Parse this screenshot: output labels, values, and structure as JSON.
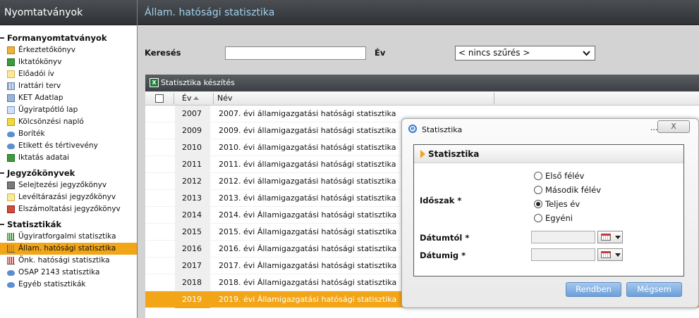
{
  "sidebar": {
    "title": "Nyomtatványok",
    "sections": [
      {
        "label": "Formanyomtatványok",
        "items": [
          {
            "label": "Érkeztetőkönyv",
            "icon": "book-icon"
          },
          {
            "label": "Iktatókönyv",
            "icon": "check-icon"
          },
          {
            "label": "Előadói ív",
            "icon": "note-icon"
          },
          {
            "label": "Irattári terv",
            "icon": "grid-icon"
          },
          {
            "label": "KET Adatlap",
            "icon": "form-icon"
          },
          {
            "label": "Ügyiratpótló lap",
            "icon": "page-icon"
          },
          {
            "label": "Kölcsönzési napló",
            "icon": "log-icon"
          },
          {
            "label": "Boríték",
            "icon": "envelope-icon"
          },
          {
            "label": "Etikett és tértivevény",
            "icon": "envelope-icon"
          },
          {
            "label": "Iktatás adatai",
            "icon": "check-icon"
          }
        ]
      },
      {
        "label": "Jegyzőkönyvek",
        "items": [
          {
            "label": "Selejtezési jegyzőkönyv",
            "icon": "doc-icon"
          },
          {
            "label": "Levéltárazási jegyzőkönyv",
            "icon": "note-icon"
          },
          {
            "label": "Elszámoltatási jegyzőkönyv",
            "icon": "doc-red-icon"
          }
        ]
      },
      {
        "label": "Statisztikák",
        "items": [
          {
            "label": "Ügyiratforgalmi statisztika",
            "icon": "chart-icon"
          },
          {
            "label": "Állam. hatósági statisztika",
            "icon": "chart-icon",
            "active": true
          },
          {
            "label": "Önk. hatósági statisztika",
            "icon": "chart-icon"
          },
          {
            "label": "OSAP 2143 statisztika",
            "icon": "envelope-icon"
          },
          {
            "label": "Egyéb statisztikák",
            "icon": "envelope-icon"
          }
        ]
      }
    ]
  },
  "header": {
    "title": "Állam. hatósági statisztika"
  },
  "filter": {
    "search_label": "Keresés",
    "search_value": "",
    "year_label": "Év",
    "year_selected": "< nincs szűrés >"
  },
  "grid": {
    "toolbar_label": "Statisztika készítés",
    "col_year": "Év",
    "col_name": "Név",
    "rows": [
      {
        "year": "2007",
        "name": "2007. évi államigazgatási hatósági statisztika"
      },
      {
        "year": "2009",
        "name": "2009. évi államigazgatási hatósági statisztika"
      },
      {
        "year": "2010",
        "name": "2010. évi államigazgatási hatósági statisztika"
      },
      {
        "year": "2011",
        "name": "2011. évi államigazgatási hatósági statisztika"
      },
      {
        "year": "2012",
        "name": "2012. évi államigazgatási hatósági statisztika"
      },
      {
        "year": "2013",
        "name": "2013. évi államigazgatási hatósági statisztika"
      },
      {
        "year": "2014",
        "name": "2014. évi Államigazgatási hatósági statisztika"
      },
      {
        "year": "2015",
        "name": "2015. évi Államigazgatási hatósági statisztika"
      },
      {
        "year": "2016",
        "name": "2016. évi Államigazgatási hatósági statisztika"
      },
      {
        "year": "2017",
        "name": "2017. évi Államigazgatási hatósági statisztika"
      },
      {
        "year": "2018",
        "name": "2018. évi Államigazgatási hatósági statisztika"
      },
      {
        "year": "2019",
        "name": "2019. évi Államigazgatási hatósági statisztika",
        "selected": true
      }
    ]
  },
  "dialog": {
    "window_title": "Statisztika",
    "dots": "...",
    "close_label": "X",
    "panel_title": "Statisztika",
    "period_label": "Időszak *",
    "options": [
      {
        "label": "Első félév",
        "checked": false
      },
      {
        "label": "Második félév",
        "checked": false
      },
      {
        "label": "Teljes év",
        "checked": true
      },
      {
        "label": "Egyéni",
        "checked": false
      }
    ],
    "from_label": "Dátumtól *",
    "to_label": "Dátumig *",
    "from_value": "",
    "to_value": "",
    "ok_label": "Rendben",
    "cancel_label": "Mégsem"
  },
  "colors": {
    "accent": "#f2a516",
    "header_bg": "#3a3d40",
    "title_text": "#9fd0ec",
    "button": "#6b9fd8"
  }
}
